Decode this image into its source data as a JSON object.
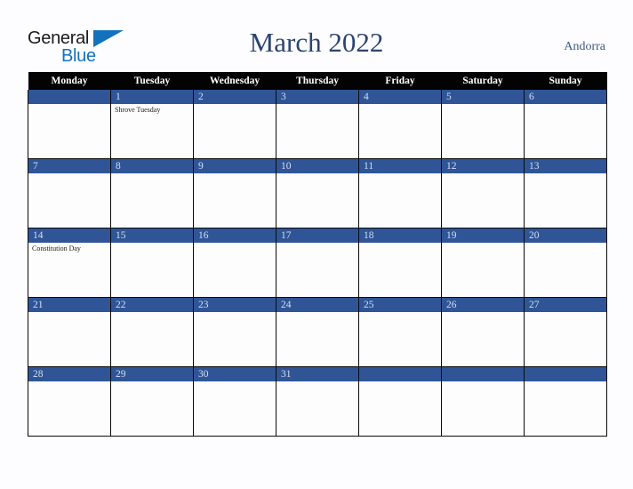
{
  "brand": {
    "name_part1": "General",
    "name_part2": "Blue",
    "triangle_icon": "triangle-icon",
    "primary_color": "#1272bd"
  },
  "header": {
    "title": "March 2022",
    "region": "Andorra",
    "title_color": "#2b4570",
    "region_color": "#3f5885"
  },
  "calendar": {
    "month": "March",
    "year": "2022",
    "weekday_headers": [
      "Monday",
      "Tuesday",
      "Wednesday",
      "Thursday",
      "Friday",
      "Saturday",
      "Sunday"
    ],
    "header_bg": "#030303",
    "header_text": "#ffffff",
    "daynum_bg": "#2f5597",
    "daynum_text": "#d7dfee",
    "cell_bg": "#fdfdfd",
    "grid_line": "#0a0a0a",
    "weeks": [
      [
        {
          "day": "",
          "events": []
        },
        {
          "day": "1",
          "events": [
            "Shrove Tuesday"
          ]
        },
        {
          "day": "2",
          "events": []
        },
        {
          "day": "3",
          "events": []
        },
        {
          "day": "4",
          "events": []
        },
        {
          "day": "5",
          "events": []
        },
        {
          "day": "6",
          "events": []
        }
      ],
      [
        {
          "day": "7",
          "events": []
        },
        {
          "day": "8",
          "events": []
        },
        {
          "day": "9",
          "events": []
        },
        {
          "day": "10",
          "events": []
        },
        {
          "day": "11",
          "events": []
        },
        {
          "day": "12",
          "events": []
        },
        {
          "day": "13",
          "events": []
        }
      ],
      [
        {
          "day": "14",
          "events": [
            "Constitution Day"
          ]
        },
        {
          "day": "15",
          "events": []
        },
        {
          "day": "16",
          "events": []
        },
        {
          "day": "17",
          "events": []
        },
        {
          "day": "18",
          "events": []
        },
        {
          "day": "19",
          "events": []
        },
        {
          "day": "20",
          "events": []
        }
      ],
      [
        {
          "day": "21",
          "events": []
        },
        {
          "day": "22",
          "events": []
        },
        {
          "day": "23",
          "events": []
        },
        {
          "day": "24",
          "events": []
        },
        {
          "day": "25",
          "events": []
        },
        {
          "day": "26",
          "events": []
        },
        {
          "day": "27",
          "events": []
        }
      ],
      [
        {
          "day": "28",
          "events": []
        },
        {
          "day": "29",
          "events": []
        },
        {
          "day": "30",
          "events": []
        },
        {
          "day": "31",
          "events": []
        },
        {
          "day": "",
          "events": []
        },
        {
          "day": "",
          "events": []
        },
        {
          "day": "",
          "events": []
        }
      ]
    ]
  }
}
